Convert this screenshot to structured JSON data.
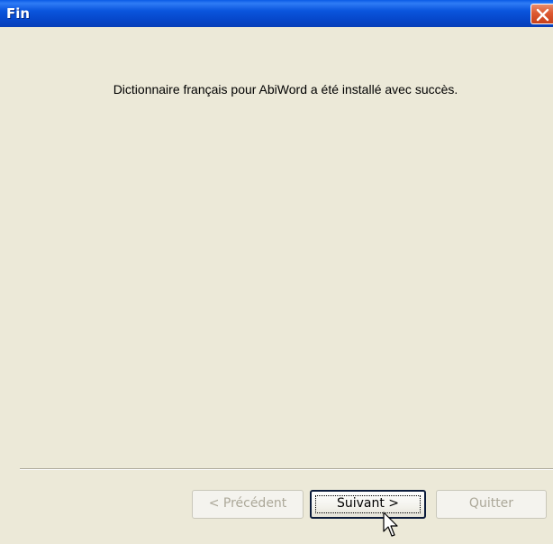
{
  "window": {
    "title": "Fin"
  },
  "content": {
    "message": "Dictionnaire français pour AbiWord a été installé avec succès."
  },
  "buttons": {
    "previous": {
      "label": "< Précédent",
      "enabled": false
    },
    "next": {
      "label": "Suivant >",
      "enabled": true,
      "focused": true
    },
    "quit": {
      "label": "Quitter",
      "enabled": false
    }
  },
  "colors": {
    "titlebar": "#0a55dd",
    "dialog_background": "#ece9d8",
    "close_button": "#dd5a32",
    "disabled_text": "#aca899"
  },
  "icons": {
    "close": "close-icon",
    "cursor": "mouse-pointer-icon"
  }
}
